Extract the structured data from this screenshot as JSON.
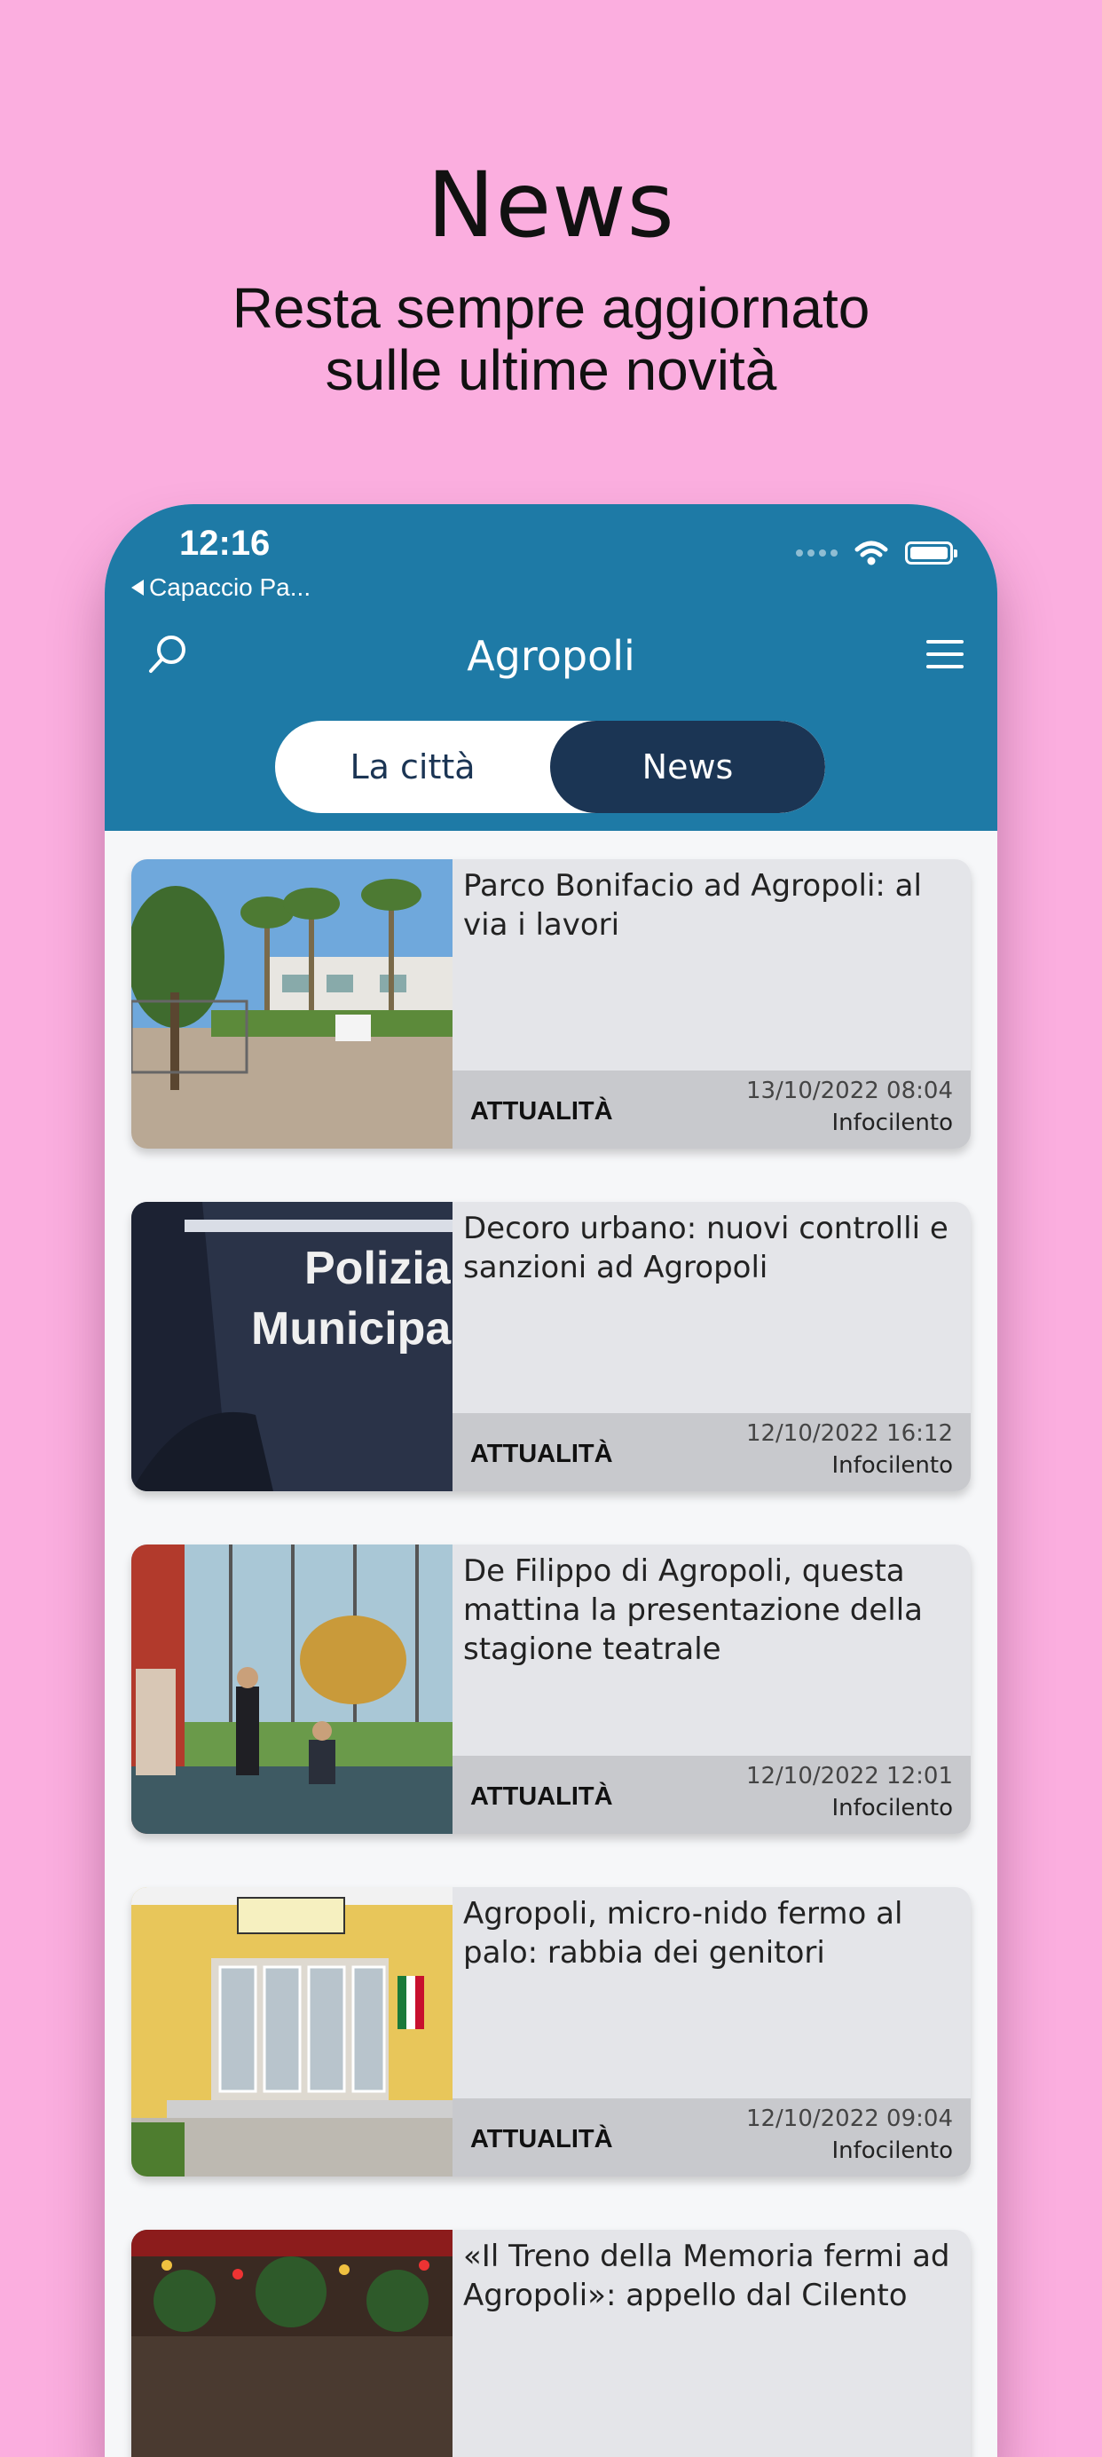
{
  "promo": {
    "title": "News",
    "subtitle_line1": "Resta sempre aggiornato",
    "subtitle_line2": "sulle ultime novità"
  },
  "status_bar": {
    "time": "12:16",
    "back_app": "Capaccio Pa..."
  },
  "nav": {
    "title": "Agropoli",
    "search_icon": "search-icon",
    "menu_icon": "hamburger-menu-icon"
  },
  "tabs": [
    {
      "label": "La città",
      "active": false
    },
    {
      "label": "News",
      "active": true
    }
  ],
  "colors": {
    "background": "#fbaedf",
    "appbar": "#1e7aa6",
    "tab_active": "#1b3554",
    "card": "#e4e5e9",
    "card_footer": "#c8c9cd"
  },
  "news": [
    {
      "title": "Parco Bonifacio ad Agropoli: al via i lavori",
      "category": "ATTUALITÀ",
      "date": "13/10/2022 08:04",
      "source": "Infocilento"
    },
    {
      "title": "Decoro urbano: nuovi controlli e sanzioni ad Agropoli",
      "category": "ATTUALITÀ",
      "date": "12/10/2022 16:12",
      "source": "Infocilento",
      "image_text_1": "Polizia",
      "image_text_2": "Municipa"
    },
    {
      "title": "De Filippo di Agropoli, questa mattina la presentazione della stagione teatrale",
      "category": "ATTUALITÀ",
      "date": "12/10/2022 12:01",
      "source": "Infocilento"
    },
    {
      "title": "Agropoli, micro-nido fermo al palo: rabbia dei genitori",
      "category": "ATTUALITÀ",
      "date": "12/10/2022 09:04",
      "source": "Infocilento"
    },
    {
      "title": "«Il Treno della Memoria fermi ad Agropoli»: appello dal Cilento",
      "category": "",
      "date": "",
      "source": ""
    }
  ]
}
